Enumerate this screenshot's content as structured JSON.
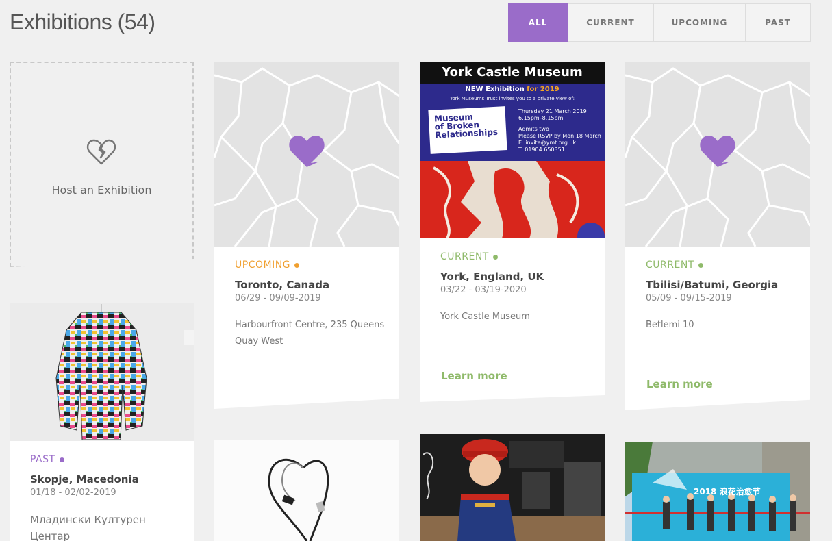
{
  "header": {
    "title": "Exhibitions (54)"
  },
  "filters": [
    {
      "label": "ALL",
      "active": true
    },
    {
      "label": "CURRENT",
      "active": false
    },
    {
      "label": "UPCOMING",
      "active": false
    },
    {
      "label": "PAST",
      "active": false
    }
  ],
  "colors": {
    "accent": "#9a6cc9",
    "upcoming": "#f0a030",
    "current": "#8fba6a",
    "past": "#9a6cc9"
  },
  "host": {
    "label": "Host an Exhibition",
    "icon": "broken-heart-icon"
  },
  "cards": [
    {
      "status": "UPCOMING",
      "place": "Toronto, Canada",
      "dates": "06/29 - 09/09-2019",
      "venue": "Harbourfront Centre, 235 Queens Quay West"
    },
    {
      "status": "CURRENT",
      "place": "York, England, UK",
      "dates": "03/22 - 03/19-2020",
      "venue": "York Castle Museum",
      "learn_more": "Learn more",
      "poster": {
        "title": "York Castle Museum",
        "subtitle_new": "NEW Exhibition",
        "subtitle_year": " for 2019",
        "invite": "York Museums Trust invites you to a private view of:",
        "logo_lines": [
          "Museum",
          "of Broken",
          "Relationships"
        ],
        "date": "Thursday 21 March 2019",
        "time": "6.15pm–8.15pm",
        "admits": "Admits two",
        "rsvp": "Please RSVP by Mon 18 March",
        "email": "E: invite@ymt.org.uk",
        "phone": "T: 01904 650351"
      }
    },
    {
      "status": "CURRENT",
      "place": "Tbilisi/Batumi, Georgia",
      "dates": "05/09 - 09/15-2019",
      "venue": "Betlemi 10",
      "learn_more": "Learn more"
    },
    {
      "status": "PAST",
      "place": "Skopje, Macedonia",
      "dates": "01/18 - 02/02-2019",
      "venue": "Младински Културен Центар"
    }
  ],
  "banner_text": "2018 浪花治愈节"
}
